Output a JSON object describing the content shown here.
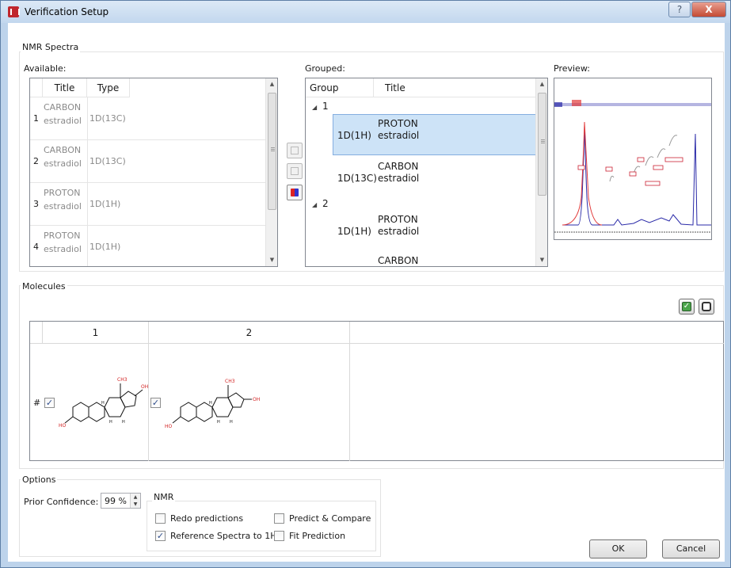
{
  "window": {
    "title": "Verification Setup",
    "help_label": "?",
    "close_label": "X"
  },
  "nmr": {
    "group_title": "NMR Spectra",
    "available_label": "Available:",
    "grouped_label": "Grouped:",
    "preview_label": "Preview:",
    "available": {
      "columns": [
        "Title",
        "Type"
      ],
      "rows": [
        {
          "num": "1",
          "title_line1": "CARBON",
          "title_line2": "estradiol",
          "type": "1D(13C)"
        },
        {
          "num": "2",
          "title_line1": "CARBON",
          "title_line2": "estradiol",
          "type": "1D(13C)"
        },
        {
          "num": "3",
          "title_line1": "PROTON",
          "title_line2": "estradiol",
          "type": "1D(1H)"
        },
        {
          "num": "4",
          "title_line1": "PROTON",
          "title_line2": "estradiol",
          "type": "1D(1H)"
        }
      ]
    },
    "grouped": {
      "columns": [
        "Group",
        "Title"
      ],
      "groups": [
        {
          "label": "1",
          "expander": "◢",
          "items": [
            {
              "type": "1D(1H)",
              "title_line1": "PROTON",
              "title_line2": "estradiol",
              "selected": true
            },
            {
              "type": "1D(13C)",
              "title_line1": "CARBON",
              "title_line2": "estradiol",
              "selected": false
            }
          ]
        },
        {
          "label": "2",
          "expander": "◢",
          "items": [
            {
              "type": "1D(1H)",
              "title_line1": "PROTON",
              "title_line2": "estradiol",
              "selected": false
            },
            {
              "type": "",
              "title_line1": "CARBON",
              "title_line2": "",
              "selected": false
            }
          ]
        }
      ]
    }
  },
  "molecules": {
    "group_title": "Molecules",
    "columns": [
      "1",
      "2"
    ],
    "row_header": "#",
    "items": [
      {
        "checked": true,
        "labels": [
          "CH3",
          "OH",
          "HO",
          "H",
          "H",
          "H"
        ]
      },
      {
        "checked": true,
        "labels": [
          "CH3",
          "OH",
          "HO",
          "H",
          "H",
          "H"
        ]
      }
    ]
  },
  "options": {
    "group_title": "Options",
    "prior_confidence_label": "Prior Confidence:",
    "prior_confidence_value": "99 %",
    "nmr_group_title": "NMR",
    "checkboxes": [
      {
        "label": "Redo predictions",
        "checked": false
      },
      {
        "label": "Predict & Compare",
        "checked": false
      },
      {
        "label": "Reference Spectra to 1H",
        "checked": true
      },
      {
        "label": "Fit Prediction",
        "checked": false
      }
    ]
  },
  "buttons": {
    "ok": "OK",
    "cancel": "Cancel"
  },
  "check_glyph": "✓",
  "colors": {
    "selection": "#cde3f7",
    "molecule_red": "#d21f1f",
    "spectrum_red": "#e23b3b",
    "spectrum_blue": "#2a2aa8"
  }
}
